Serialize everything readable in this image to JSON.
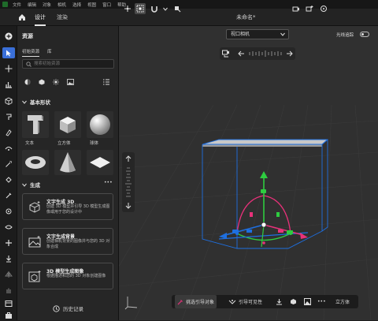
{
  "menubar": {
    "items": [
      "文件",
      "编辑",
      "对象",
      "相机",
      "选择",
      "视图",
      "窗口",
      "帮助"
    ]
  },
  "tabs": [
    "设计",
    "渲染"
  ],
  "document": {
    "title": "未命名*"
  },
  "panel": {
    "title": "资源",
    "tabs": [
      "初始资源",
      "库"
    ],
    "search_placeholder": "搜索初始资源",
    "basic_shapes": {
      "title": "基本形状",
      "items": [
        "文本",
        "立方体",
        "球体"
      ]
    },
    "generate": {
      "title": "生成",
      "more": "•••",
      "cards": [
        {
          "title": "文字生成 3D",
          "desc": "创建 3D 模型并引导 3D 模型生成图像或用于您的设计中"
        },
        {
          "title": "文字生成背景",
          "desc": "创建相机背景的图像并与您的 3D 对象合成"
        },
        {
          "title": "3D 模型生成图像",
          "desc": "根据描述和您的 3D 对象创建图像"
        }
      ]
    },
    "history": "历史记录"
  },
  "viewport": {
    "camera": "视口相机",
    "raytrace": "光线追踪",
    "bottom": {
      "lead": "挑选引导对象",
      "guide_vis": "引导可见性",
      "more": "•••",
      "cube": "立方体"
    }
  },
  "colors": {
    "accent": "#3a6fd8",
    "gizmo_green": "#2ecc40",
    "gizmo_pink": "#e8317a",
    "gizmo_blue": "#1e6fe0",
    "bbox": "#1e6fe0"
  }
}
